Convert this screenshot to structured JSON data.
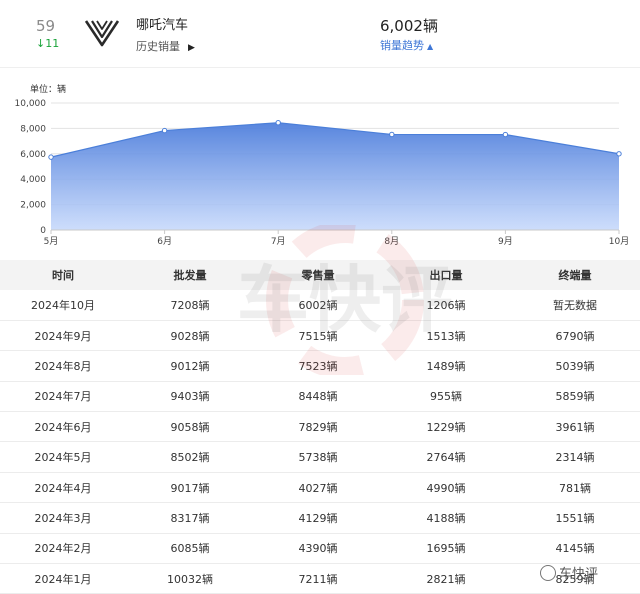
{
  "header": {
    "rank": "59",
    "rank_change_arrow": "↓",
    "rank_change": "11",
    "brand_name": "哪吒汽车",
    "history_label": "历史销量",
    "history_arrow": "▶",
    "sales_value": "6,002辆",
    "trend_label": "销量趋势",
    "trend_arrow": "▲",
    "logo_icon": "neta-brand-logo-icon"
  },
  "chart_data": {
    "type": "area",
    "unit_label": "单位：辆",
    "x": [
      "5月",
      "6月",
      "7月",
      "8月",
      "9月",
      "10月"
    ],
    "values": [
      5738,
      7829,
      8448,
      7523,
      7515,
      6002
    ],
    "ylim": [
      0,
      10000
    ],
    "yticks": [
      0,
      2000,
      4000,
      6000,
      8000,
      10000
    ],
    "ytick_labels": [
      "0",
      "2,000",
      "4,000",
      "6,000",
      "8,000",
      "10,000"
    ],
    "grid": true,
    "line_color": "#4b7fd9",
    "fill_top_color": "#4f7fdc",
    "fill_bottom_color": "#c4d7fb"
  },
  "table": {
    "headers": [
      "时间",
      "批发量",
      "零售量",
      "出口量",
      "终端量"
    ],
    "rows": [
      [
        "2024年10月",
        "7208辆",
        "6002辆",
        "1206辆",
        "暂无数据"
      ],
      [
        "2024年9月",
        "9028辆",
        "7515辆",
        "1513辆",
        "6790辆"
      ],
      [
        "2024年8月",
        "9012辆",
        "7523辆",
        "1489辆",
        "5039辆"
      ],
      [
        "2024年7月",
        "9403辆",
        "8448辆",
        "955辆",
        "5859辆"
      ],
      [
        "2024年6月",
        "9058辆",
        "7829辆",
        "1229辆",
        "3961辆"
      ],
      [
        "2024年5月",
        "8502辆",
        "5738辆",
        "2764辆",
        "2314辆"
      ],
      [
        "2024年4月",
        "9017辆",
        "4027辆",
        "4990辆",
        "781辆"
      ],
      [
        "2024年3月",
        "8317辆",
        "4129辆",
        "4188辆",
        "1551辆"
      ],
      [
        "2024年2月",
        "6085辆",
        "4390辆",
        "1695辆",
        "4145辆"
      ],
      [
        "2024年1月",
        "10032辆",
        "7211辆",
        "2821辆",
        "8259辆"
      ]
    ]
  },
  "watermark": {
    "center_text": "车快评",
    "corner_text": "车快评"
  }
}
